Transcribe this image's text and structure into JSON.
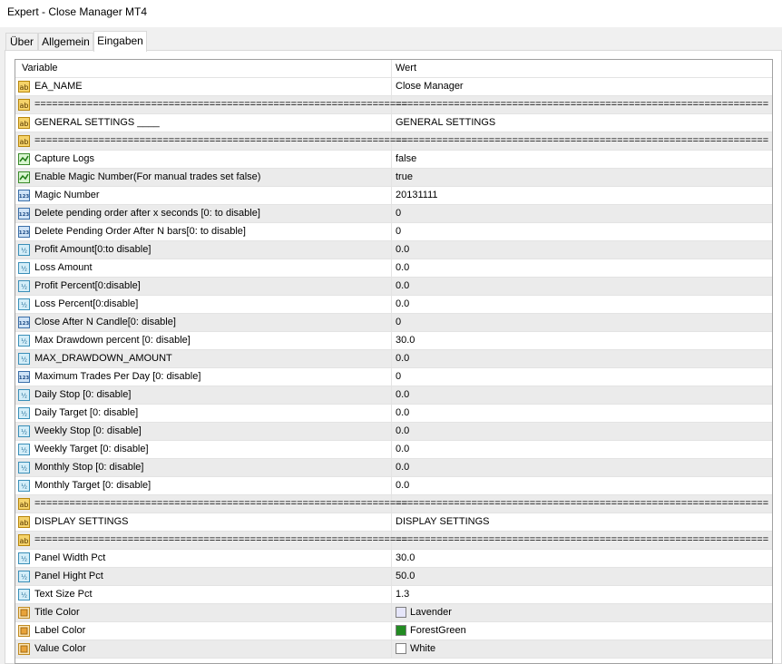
{
  "window": {
    "title": "Expert - Close Manager MT4"
  },
  "tabs": [
    {
      "label": "Über"
    },
    {
      "label": "Allgemein"
    },
    {
      "label": "Eingaben"
    }
  ],
  "table": {
    "headers": {
      "variable": "Variable",
      "value": "Wert"
    },
    "rows": [
      {
        "type": "ab",
        "variable": "EA_NAME",
        "value": "Close Manager"
      },
      {
        "type": "ab",
        "variable": "================================================================",
        "value": "================================================================"
      },
      {
        "type": "ab",
        "variable": "GENERAL SETTINGS ____",
        "value": "GENERAL SETTINGS"
      },
      {
        "type": "ab",
        "variable": "================================================================",
        "value": "================================================================"
      },
      {
        "type": "bool",
        "variable": "Capture Logs",
        "value": "false"
      },
      {
        "type": "bool",
        "variable": "Enable Magic Number(For manual trades set false)",
        "value": "true"
      },
      {
        "type": "int",
        "variable": "Magic Number",
        "value": "20131111"
      },
      {
        "type": "int",
        "variable": "Delete pending order after x seconds [0: to disable]",
        "value": "0"
      },
      {
        "type": "int",
        "variable": "Delete Pending Order After N bars[0: to disable]",
        "value": "0"
      },
      {
        "type": "double",
        "variable": "Profit Amount[0:to disable]",
        "value": "0.0"
      },
      {
        "type": "double",
        "variable": "Loss Amount",
        "value": "0.0"
      },
      {
        "type": "double",
        "variable": "Profit Percent[0:disable]",
        "value": "0.0"
      },
      {
        "type": "double",
        "variable": "Loss Percent[0:disable]",
        "value": "0.0"
      },
      {
        "type": "int",
        "variable": "Close After N Candle[0: disable]",
        "value": "0"
      },
      {
        "type": "double",
        "variable": "Max Drawdown percent [0: disable]",
        "value": "30.0"
      },
      {
        "type": "double",
        "variable": "MAX_DRAWDOWN_AMOUNT",
        "value": "0.0"
      },
      {
        "type": "int",
        "variable": "Maximum Trades Per Day [0: disable]",
        "value": "0"
      },
      {
        "type": "double",
        "variable": "Daily Stop [0: disable]",
        "value": "0.0"
      },
      {
        "type": "double",
        "variable": "Daily Target [0: disable]",
        "value": "0.0"
      },
      {
        "type": "double",
        "variable": "Weekly Stop [0: disable]",
        "value": "0.0"
      },
      {
        "type": "double",
        "variable": "Weekly Target [0: disable]",
        "value": "0.0"
      },
      {
        "type": "double",
        "variable": "Monthly Stop [0: disable]",
        "value": "0.0"
      },
      {
        "type": "double",
        "variable": "Monthly Target [0: disable]",
        "value": "0.0"
      },
      {
        "type": "ab",
        "variable": "================================================================",
        "value": "================================================================"
      },
      {
        "type": "ab",
        "variable": "DISPLAY SETTINGS",
        "value": "DISPLAY SETTINGS"
      },
      {
        "type": "ab",
        "variable": "================================================================",
        "value": "================================================================"
      },
      {
        "type": "double",
        "variable": "Panel Width Pct",
        "value": "30.0"
      },
      {
        "type": "double",
        "variable": "Panel Hight Pct",
        "value": "50.0"
      },
      {
        "type": "double",
        "variable": "Text Size Pct",
        "value": "1.3"
      },
      {
        "type": "color",
        "variable": "Title Color",
        "value": "Lavender",
        "swatch": "#e6e6fa"
      },
      {
        "type": "color",
        "variable": "Label Color",
        "value": "ForestGreen",
        "swatch": "#228b22"
      },
      {
        "type": "color",
        "variable": "Value Color",
        "value": "White",
        "swatch": "#ffffff"
      }
    ]
  },
  "icon_names": {
    "ab": "string-type-icon",
    "bool": "bool-type-icon",
    "int": "integer-type-icon",
    "double": "double-type-icon",
    "color": "color-type-icon"
  },
  "colors": {
    "row_alt": "#ebebeb",
    "row_normal": "#ffffff",
    "grid_line": "#e3e3e3"
  }
}
